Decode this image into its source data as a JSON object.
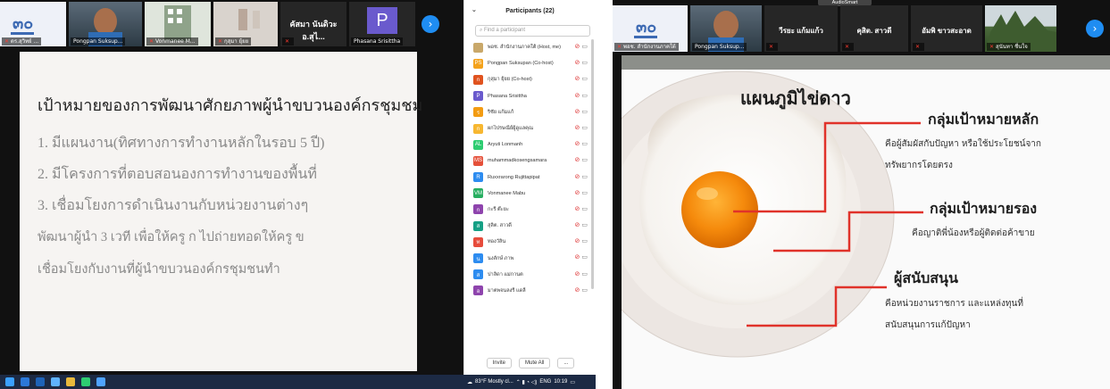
{
  "left_meeting": {
    "tiles": [
      {
        "name": "ดร.สุวิทย์ ...",
        "kind": "logo"
      },
      {
        "name": "Pongpan Suksup...",
        "kind": "person"
      },
      {
        "name": "Vonmanee M...",
        "kind": "building"
      },
      {
        "name": "กุสุมา ยุ้ยย",
        "kind": "room"
      },
      {
        "name": "",
        "kind": "text",
        "display": "คัสมา นันดิวะ อ.สุไ..."
      },
      {
        "name": "Phasana Srisittha",
        "kind": "avatar",
        "letter": "P"
      }
    ],
    "next_icon": "chevron-right-icon"
  },
  "slide_left": {
    "title": "เป้าหมายของการพัฒนาศักยภาพผู้นำขบวนองค์กรชุมชม",
    "lines": [
      "1. มีแผนงาน(ทิศทางการทำงานหลักในรอบ 5 ปี)",
      "2. มีโครงการที่ตอบสอนองการทำงานของพื้นที่",
      "3. เชื่อมโยงการดำเนินงานกับหน่วยงานต่างๆ",
      "พัฒนาผู้นำ 3 เวที เพื่อให้ครู ก ไปถ่ายทอดให้ครู ข",
      "เชื่อมโยงกับงานที่ผู้นำขบวนองค์กรชุมชนทำ"
    ]
  },
  "participants": {
    "title": "Participants (22)",
    "search_placeholder": "Find a participant",
    "items": [
      {
        "initial": "",
        "color": "#c9a86a",
        "name": "พอช. สำนักงานภาคใต้ (Host, me)"
      },
      {
        "initial": "PS",
        "color": "#f4a21b",
        "name": "Pongpan Suksupan (Co-host)"
      },
      {
        "initial": "ก",
        "color": "#e0531f",
        "name": "กุสุมา ยุ้ยย (Co-host)"
      },
      {
        "initial": "P",
        "color": "#6a5acd",
        "name": "Phasana Srisittha"
      },
      {
        "initial": "ร",
        "color": "#f39c12",
        "name": "ริชัย แก้มแก้"
      },
      {
        "initial": "ก",
        "color": "#f7b731",
        "name": "ผกไปรษณีย์ผู้ดูแลคุณ"
      },
      {
        "initial": "AL",
        "color": "#2ecc71",
        "name": "Aryuti Lonmanh"
      },
      {
        "initial": "MS",
        "color": "#e55039",
        "name": "muhammadkosengsamara"
      },
      {
        "initial": "R",
        "color": "#2d8cf0",
        "name": "Ruxxrarong Rujittapipat"
      },
      {
        "initial": "VM",
        "color": "#27ae60",
        "name": "Vonmanee Mabu"
      },
      {
        "initial": "ก",
        "color": "#8e44ad",
        "name": "กะรี ต๊ะยะ"
      },
      {
        "initial": "ส",
        "color": "#16a085",
        "name": "สุลิต. สาวดี"
      },
      {
        "initial": "ท",
        "color": "#e74c3c",
        "name": "ทองวัลิน"
      },
      {
        "initial": "น",
        "color": "#2d8cf0",
        "name": "นงลักษ์ ภาพ"
      },
      {
        "initial": "ส",
        "color": "#2d8cf0",
        "name": "ปาลิดา แม่กานต"
      },
      {
        "initial": "อ",
        "color": "#8e44ad",
        "name": "มาตพจนลงรี แดลี"
      }
    ],
    "invite_label": "Invite",
    "mute_all_label": "Mute All",
    "more_label": "..."
  },
  "taskbar": {
    "weather": "83°F Mostly cl...",
    "lang": "ENG",
    "time": "10:19"
  },
  "right_meeting": {
    "banner": "AudioSmart",
    "tiles": [
      {
        "name": "พอช. สำนักงานภาคใต้",
        "kind": "logo"
      },
      {
        "name": "Pongpan Suksup...",
        "kind": "person"
      },
      {
        "name": "",
        "kind": "text",
        "display": "วีรยะ แก้มแก้ว"
      },
      {
        "name": "",
        "kind": "text",
        "display": "คุสิต. สาวดี"
      },
      {
        "name": "",
        "kind": "text",
        "display": "อัมพิ ขาวสะอาด"
      },
      {
        "name": "สุนันทา ชื่นใจ",
        "kind": "landscape"
      }
    ]
  },
  "slide_right": {
    "title": "แผนภูมิไข่ดาว",
    "groups": [
      {
        "heading": "กลุ่มเป้าหมายหลัก",
        "desc1": "คือผู้สัมผัสกับปัญหา หรือใช้ประโยชน์จาก",
        "desc2": "ทรัพยากรโดยตรง"
      },
      {
        "heading": "กลุ่มเป้าหมายรอง",
        "desc1": "คือญาติพี่น้องหรือผู้ติดต่อค้าขาย",
        "desc2": ""
      },
      {
        "heading": "ผู้สนับสนุน",
        "desc1": "คือหน่วยงานราชการ และแหล่งทุนที่",
        "desc2": "สนับสนุนการแก้ปัญหา"
      }
    ],
    "line_color": "#e0322a"
  }
}
